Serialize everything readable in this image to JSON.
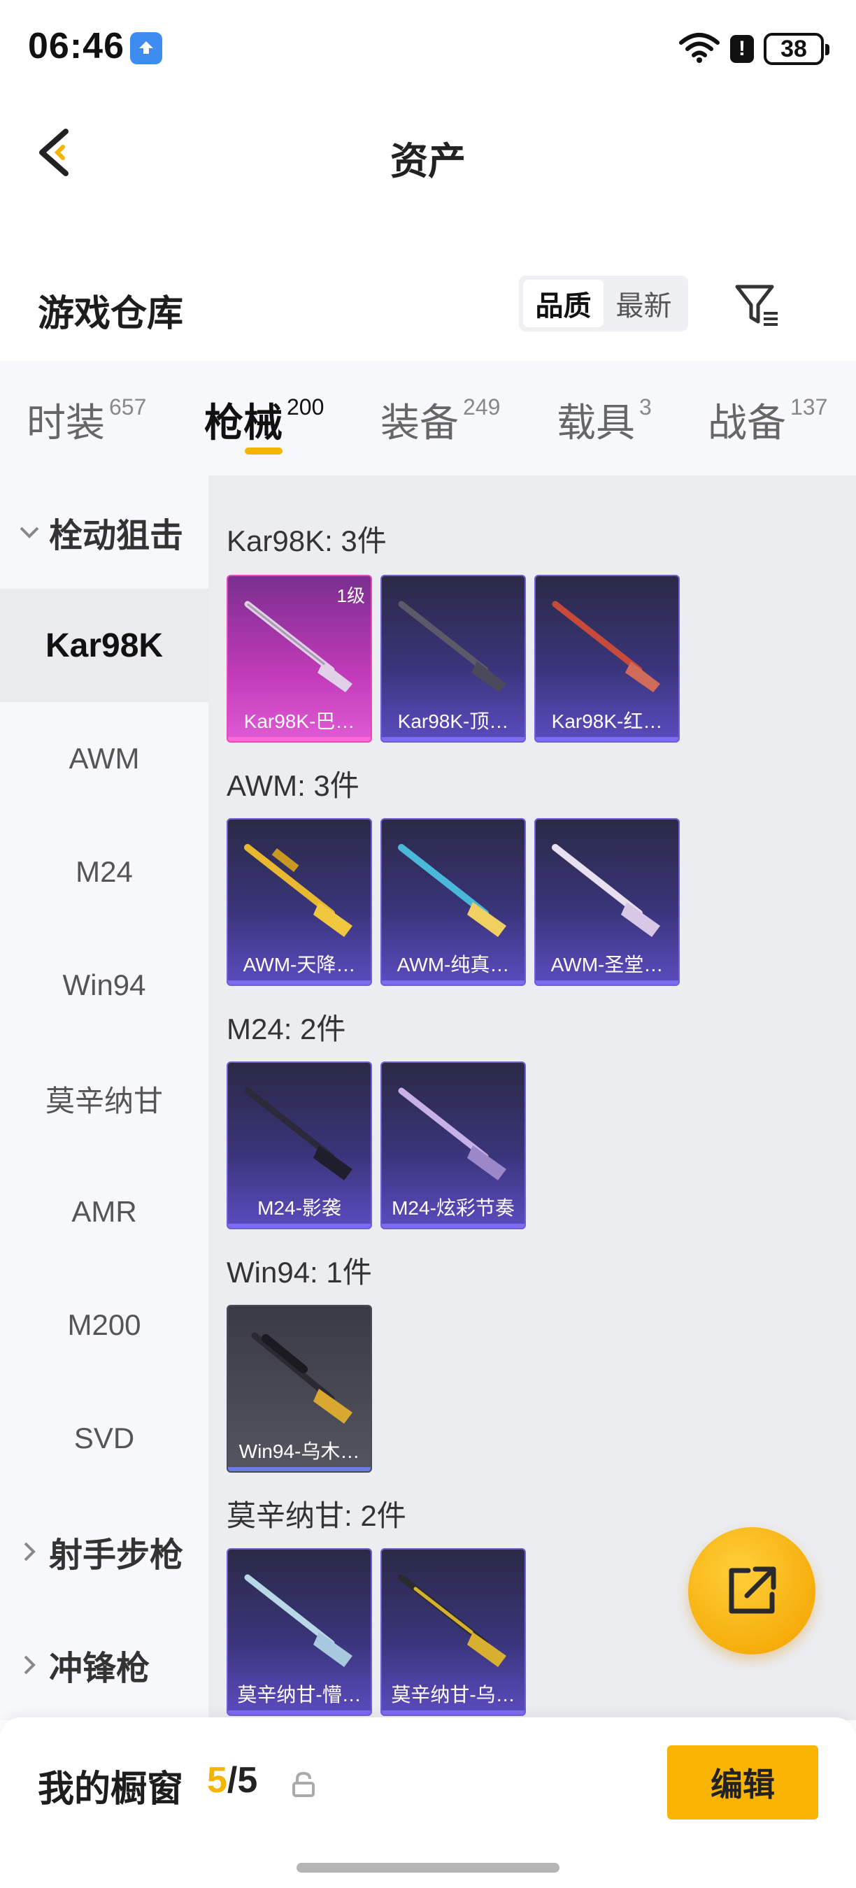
{
  "status_bar": {
    "time": "06:46",
    "battery": "38",
    "alert": "!"
  },
  "header": {
    "title": "资产"
  },
  "warehouse": {
    "title": "游戏仓库",
    "sort_options": [
      "品质",
      "最新"
    ],
    "active_sort": "品质"
  },
  "category_tabs": [
    {
      "label": "时装",
      "count": "657"
    },
    {
      "label": "枪械",
      "count": "200"
    },
    {
      "label": "装备",
      "count": "249"
    },
    {
      "label": "载具",
      "count": "3"
    },
    {
      "label": "战备",
      "count": "137"
    }
  ],
  "sidebar": {
    "group_expanded": "栓动狙击",
    "items": [
      "Kar98K",
      "AWM",
      "M24",
      "Win94",
      "莫辛纳甘",
      "AMR",
      "M200",
      "SVD"
    ],
    "active_item": "Kar98K",
    "collapsed_groups": [
      "射手步枪",
      "冲锋枪"
    ]
  },
  "sections": [
    {
      "label": "Kar98K: 3件",
      "items": [
        {
          "name": "Kar98K-巴…",
          "level": "1级",
          "rarity": "legendary",
          "color": "#e0d0e8"
        },
        {
          "name": "Kar98K-顶…",
          "rarity": "epic",
          "color": "#4a4a5a"
        },
        {
          "name": "Kar98K-红…",
          "rarity": "epic",
          "color": "#c84a3a"
        }
      ]
    },
    {
      "label": "AWM: 3件",
      "items": [
        {
          "name": "AWM-天降…",
          "rarity": "epic",
          "color": "#e8b830"
        },
        {
          "name": "AWM-纯真…",
          "rarity": "epic",
          "color": "#4ab8d8"
        },
        {
          "name": "AWM-圣堂…",
          "rarity": "epic",
          "color": "#e8e0f0"
        }
      ]
    },
    {
      "label": "M24: 2件",
      "items": [
        {
          "name": "M24-影袭",
          "rarity": "epic",
          "color": "#2a2a3a"
        },
        {
          "name": "M24-炫彩节奏",
          "rarity": "epic",
          "color": "#c8b0e8"
        }
      ]
    },
    {
      "label": "Win94: 1件",
      "items": [
        {
          "name": "Win94-乌木…",
          "rarity": "common",
          "color": "#d8a830"
        }
      ]
    },
    {
      "label": "莫辛纳甘: 2件",
      "items": [
        {
          "name": "莫辛纳甘-懵…",
          "rarity": "epic",
          "color": "#b8d8e8"
        },
        {
          "name": "莫辛纳甘-乌…",
          "rarity": "epic",
          "color": "#d8b030"
        }
      ]
    }
  ],
  "showcase": {
    "label": "我的橱窗",
    "current": "5",
    "separator": "/",
    "max": "5"
  },
  "edit_label": "编辑"
}
